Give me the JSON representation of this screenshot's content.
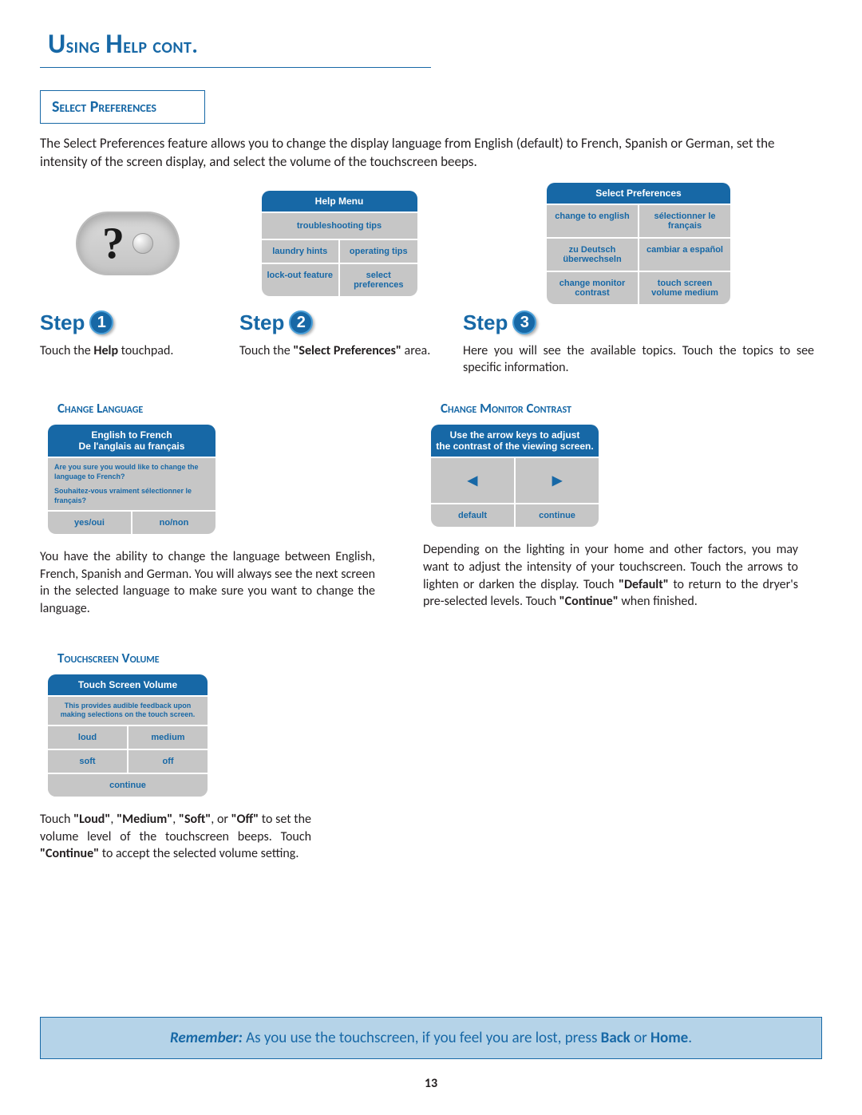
{
  "title": "Using Help cont.",
  "section": "Select Preferences",
  "intro": "The Select Preferences feature allows you to change the display language from English (default) to French, Spanish or German, set the intensity of the screen display, and select the volume of the touchscreen beeps.",
  "steps": {
    "word": "Step",
    "s1": {
      "num": "1",
      "text_a": "Touch the ",
      "text_b": "Help",
      "text_c": " touchpad."
    },
    "s2": {
      "num": "2",
      "text_a": "Touch the ",
      "text_b": "\"Select Preferences\"",
      "text_c": " area."
    },
    "s3": {
      "num": "3",
      "text": "Here you will see the available topics. Touch the topics to see specific information."
    }
  },
  "help_icon": {
    "q": "?",
    "dot": ""
  },
  "help_menu": {
    "title": "Help Menu",
    "wide": "troubleshooting tips",
    "r1a": "laundry hints",
    "r1b": "operating tips",
    "r2a": "lock-out feature",
    "r2b": "select preferences"
  },
  "prefs_menu": {
    "title": "Select Preferences",
    "r1a": "change to english",
    "r1b": "sélectionner le français",
    "r2a": "zu Deutsch überwechseln",
    "r2b": "cambiar a español",
    "r3a": "change monitor contrast",
    "r3b": "touch screen volume medium"
  },
  "change_lang": {
    "title": "Change Language",
    "hdr1": "English to French",
    "hdr2": "De l'anglais au français",
    "q1": "Are you sure you would like to change the language to French?",
    "q2": "Souhaitez-vous vraiment sélectionner le français?",
    "yes": "yes/oui",
    "no": "no/non",
    "body": "You have the ability to change the language between English, French, Spanish and German. You will always see the next screen in the selected language to make sure you want to change the language."
  },
  "contrast": {
    "title": "Change Monitor Contrast",
    "hdr1": "Use the arrow keys to adjust",
    "hdr2": "the contrast of the viewing screen.",
    "left": "◀",
    "right": "▶",
    "default": "default",
    "continue": "continue",
    "body_a": "Depending on the lighting in your home and other factors, you may want to adjust the intensity of your touchscreen. Touch the arrows to lighten or darken the display. Touch ",
    "body_b": "\"Default\"",
    "body_c": " to return to the dryer's pre-selected levels. Touch ",
    "body_d": "\"Continue\"",
    "body_e": " when finished."
  },
  "volume": {
    "title": "Touchscreen Volume",
    "hdr": "Touch Screen Volume",
    "note": "This provides audible feedback upon making selections on the touch screen.",
    "loud": "loud",
    "medium": "medium",
    "soft": "soft",
    "off": "off",
    "continue": "continue",
    "body_a": "Touch ",
    "body_b": "\"Loud\"",
    "body_c": ", ",
    "body_d": "\"Medium\"",
    "body_e": ", ",
    "body_f": "\"Soft\"",
    "body_g": ", or ",
    "body_h": "\"Off\"",
    "body_i": " to set the volume level of the touchscreen beeps. Touch ",
    "body_j": "\"Continue\"",
    "body_k": " to accept the selected volume setting."
  },
  "remember": {
    "label": "Remember:",
    "text_a": " As you use the touchscreen, if you feel you are lost, press ",
    "back": "Back",
    "or": " or ",
    "home": "Home",
    "dot": "."
  },
  "page_number": "13"
}
